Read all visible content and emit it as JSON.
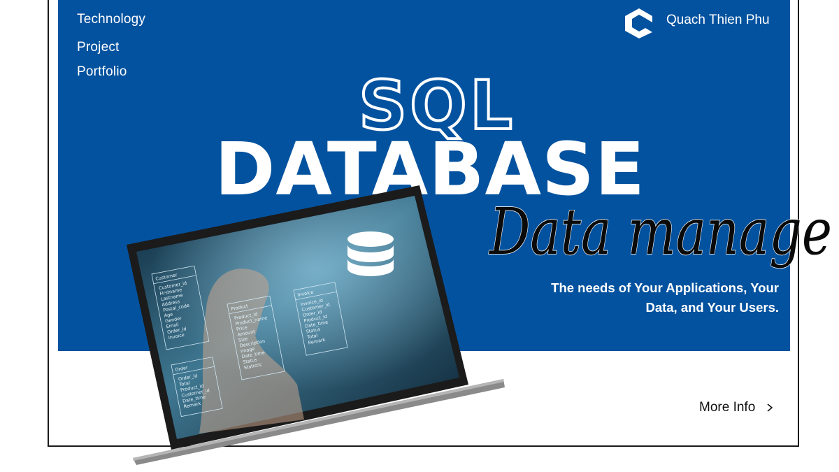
{
  "nav": {
    "technology": "Technology",
    "project": "Project",
    "portfolio": "Portfolio"
  },
  "brand": {
    "name": "Quach Thien Phu",
    "logo_icon": "cube-logo-icon"
  },
  "hero": {
    "outline_title": "SQL",
    "main_title": "DATABASE",
    "script_title": "Data manage",
    "tagline_line1": "The needs of Your Applications, Your",
    "tagline_line2": "Data, and Your Users."
  },
  "screen": {
    "tables": [
      {
        "name": "Customer",
        "fields": [
          "Customer_id",
          "Firstname",
          "Lastname",
          "Address",
          "Postal_code",
          "Age",
          "Gender",
          "Email",
          "Order_id",
          "Invoice"
        ]
      },
      {
        "name": "Product",
        "fields": [
          "Product_id",
          "Product_name",
          "Price",
          "Amount",
          "Size",
          "Description",
          "Image",
          "Date_time",
          "Status",
          "Statistic"
        ]
      },
      {
        "name": "Invoice",
        "fields": [
          "Invoice_id",
          "Customer_id",
          "Order_id",
          "Product_id",
          "Date_time",
          "Status",
          "Total",
          "Remark"
        ]
      },
      {
        "name": "Order",
        "fields": [
          "Order_id",
          "Total",
          "Product_id",
          "Customer_id",
          "Date_time",
          "Remark"
        ]
      }
    ],
    "database_icon": "database-cylinder-icon"
  },
  "cta": {
    "label": "More Info",
    "icon": "chevron-right-icon"
  },
  "colors": {
    "banner_blue": "#03529f",
    "text_white": "#ffffff",
    "script_black": "#0a0a0a",
    "frame_border": "#1a1a1a"
  }
}
